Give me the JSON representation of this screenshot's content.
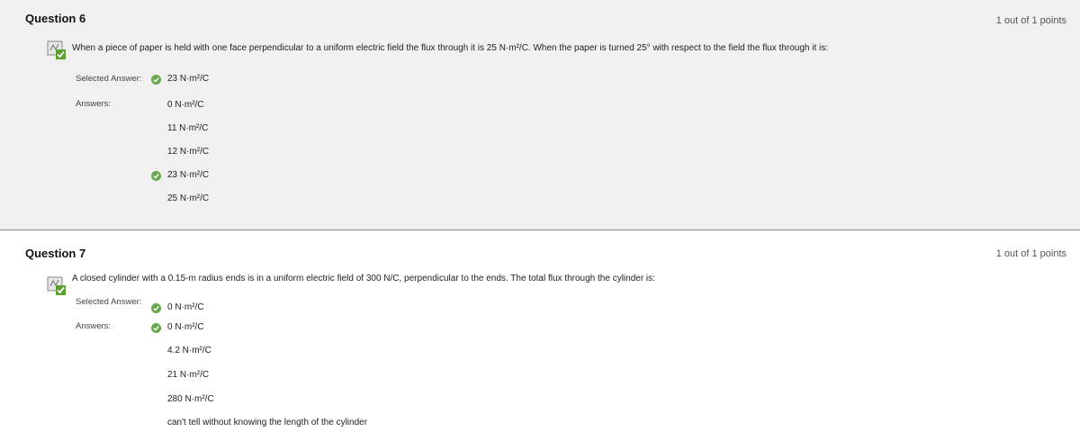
{
  "questions": [
    {
      "title": "Question 6",
      "points": "1 out of 1 points",
      "text": "When a piece of paper is held with one face perpendicular to a uniform electric field the flux through it is 25 N·m²/C. When the paper is turned 25° with respect to the field the flux through it is:",
      "selected_label": "Selected Answer:",
      "answers_label": "Answers:",
      "selected_answer": "23 N·m²/C",
      "answers": [
        {
          "text": "0 N·m²/C",
          "correct": false
        },
        {
          "text": "11 N·m²/C",
          "correct": false
        },
        {
          "text": "12 N·m²/C",
          "correct": false
        },
        {
          "text": "23 N·m²/C",
          "correct": true
        },
        {
          "text": "25 N·m²/C",
          "correct": false
        }
      ]
    },
    {
      "title": "Question 7",
      "points": "1 out of 1 points",
      "text": "A closed cylinder with a 0.15-m radius ends is in a uniform electric field of 300 N/C, perpendicular to the ends. The total flux through the cylinder is:",
      "selected_label": "Selected Answer:",
      "answers_label": "Answers:",
      "selected_answer": "0 N·m²/C",
      "answers": [
        {
          "text": "0 N·m²/C",
          "correct": true
        },
        {
          "text": "4.2 N·m²/C",
          "correct": false
        },
        {
          "text": "21 N·m²/C",
          "correct": false
        },
        {
          "text": "280 N·m²/C",
          "correct": false
        },
        {
          "text": "can't tell without knowing the length of the cylinder",
          "correct": false
        }
      ]
    }
  ],
  "colors": {
    "correct_check": "#6aa84f",
    "header_bg": "#f0f0f0"
  },
  "icons": {
    "question_status": "graded-correct-icon",
    "answer_check": "check-circle-icon"
  }
}
